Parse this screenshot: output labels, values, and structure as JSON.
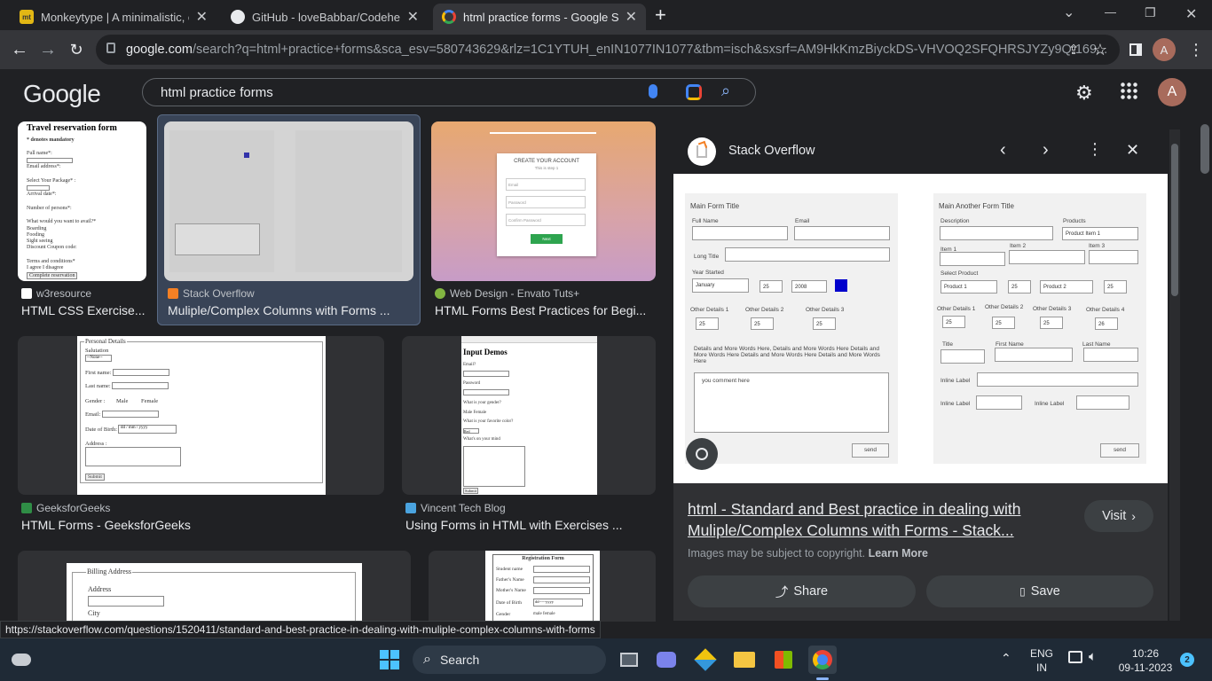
{
  "browser": {
    "tabs": [
      {
        "title": "Monkeytype | A minimalistic, cus",
        "close": "✕"
      },
      {
        "title": "GitHub - loveBabbar/CodehelpY",
        "close": "✕"
      },
      {
        "title": "html practice forms - Google Sea",
        "close": "✕"
      }
    ],
    "new_tab": "+",
    "window_controls": {
      "chevron": "⌄",
      "minimize": "—",
      "restore": "❐",
      "close": "✕"
    },
    "address": {
      "host": "google.com",
      "path": "/search?q=html+practice+forms&sca_esv=580743629&rlz=1C1YTUH_enIN1077IN1077&tbm=isch&sxsrf=AM9HkKmzBiyckDS-VHVOQ2SFQHRSJYZy9Q:169..."
    },
    "profile_initial": "A"
  },
  "google": {
    "logo": "Google",
    "query": "html practice forms",
    "avatar": "A"
  },
  "results": [
    {
      "source": "w3resource",
      "title": "HTML CSS Exercise..."
    },
    {
      "source": "Stack Overflow",
      "title": "Muliple/Complex Columns with Forms ..."
    },
    {
      "source": "Web Design - Envato Tuts+",
      "title": "HTML Forms Best Practices for Begi..."
    },
    {
      "source": "GeeksforGeeks",
      "title": "HTML Forms - GeeksforGeeks"
    },
    {
      "source": "Vincent Tech Blog",
      "title": "Using Forms in HTML with Exercises ..."
    }
  ],
  "thumbs": {
    "travel": {
      "title": "Travel reservation form",
      "note": "* denotes mandatory",
      "lines": [
        "Full name*:",
        "Email address*:",
        "Select Your Package* :",
        "Arrival date*:",
        "Number of persons*:",
        "What would you want to avail?*",
        "Boarding",
        "Fooding",
        "Sight seeing",
        "Discount Coupon code:",
        "Terms and conditions*",
        "I agree   I disagree"
      ],
      "button": "Complete reservation"
    },
    "account": {
      "heading": "CREATE YOUR ACCOUNT",
      "sub": "This is step 1",
      "fields": [
        "Email",
        "Password",
        "Confirm Password"
      ],
      "button": "Next"
    },
    "personal": {
      "legend": "Personal Details",
      "salutation": "Salutation",
      "none": "--None--",
      "first": "First name:",
      "last": "Last name:",
      "gender": "Gender :",
      "male": "Male",
      "female": "Female",
      "email": "Email:",
      "dob": "Date of Birth:",
      "dob_val": "dd / mm / yyyy",
      "address": "Address :",
      "submit": "Submit"
    },
    "input_demos": {
      "title": "Input Demos",
      "lines": [
        "Email?",
        "Password",
        "What is your gender?",
        "Male   Female",
        "What is your favorite color?",
        "Red",
        "What's on your mind"
      ],
      "button": "Submit"
    },
    "billing": {
      "legend": "Billing Address",
      "address": "Address",
      "city": "City"
    },
    "registration": {
      "title": "Registration Form",
      "rows": [
        "Student name",
        "Father's Name",
        "Mother's Name",
        "Date of Birth",
        "Gender"
      ],
      "dob_val": "dd-----yyyy",
      "gender_val": "male   female"
    }
  },
  "panel": {
    "source": "Stack Overflow",
    "form_left": {
      "title": "Main Form Title",
      "full_name": "Full Name",
      "email": "Email",
      "long_title": "Long Title",
      "year_started": "Year Started",
      "month": "January",
      "day": "25",
      "year": "2008",
      "other": [
        "Other Details 1",
        "Other Details 2",
        "Other Details 3"
      ],
      "other_val": "25",
      "details": "Details and More Words Here, Details and More Words Here Details and More Words Here Details and More Words Here Details and More Words Here",
      "comment": "you comment here",
      "send": "send"
    },
    "form_right": {
      "title": "Main Another Form Title",
      "description": "Description",
      "products": "Products",
      "product_item": "Product Item 1",
      "items": [
        "Item 1",
        "Item 2",
        "Item 3"
      ],
      "select_product": "Select Product",
      "product1": "Product 1",
      "product2": "Product 2",
      "val": "25",
      "other": [
        "Other Details 1",
        "Other Details 2",
        "Other Details 3",
        "Other Details 4"
      ],
      "other_vals": [
        "25",
        "25",
        "25",
        "26"
      ],
      "title_lab": "Title",
      "first_name": "First Name",
      "last_name": "Last Name",
      "inline": "Inline Label",
      "send": "send"
    },
    "title": "html - Standard and Best practice in dealing with Muliple/Complex Columns with Forms - Stack...",
    "visit": "Visit",
    "copyright": "Images may be subject to copyright.",
    "learn_more": "Learn More",
    "share": "Share",
    "save": "Save"
  },
  "status_url": "https://stackoverflow.com/questions/1520411/standard-and-best-practice-in-dealing-with-muliple-complex-columns-with-forms",
  "taskbar": {
    "search": "Search",
    "lang": "ENG",
    "region": "IN",
    "time": "10:26",
    "date": "09-11-2023",
    "notifications": "2"
  },
  "colors": {
    "bg": "#202124",
    "chrome": "#35363a",
    "accent": "#8ab4f8",
    "selected": "#394457",
    "taskbar": "#1f2a36"
  }
}
